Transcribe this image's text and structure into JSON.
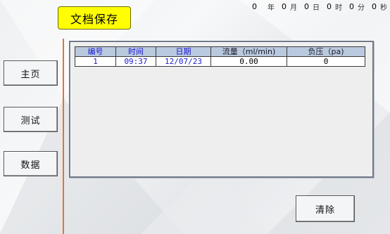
{
  "header": {
    "title": "文档保存"
  },
  "clock": {
    "year": "0",
    "year_unit": "年",
    "month": "0",
    "month_unit": "月",
    "day": "0",
    "day_unit": "日",
    "hour": "0",
    "hour_unit": "时",
    "minute": "0",
    "minute_unit": "分",
    "second": "0",
    "second_unit": "秒"
  },
  "nav": {
    "home": "主页",
    "test": "测试",
    "data": "数据"
  },
  "table": {
    "headers": [
      "编号",
      "时间",
      "日期",
      "流量（ml/min)",
      "负压（pa)"
    ],
    "rows": [
      [
        "1",
        "09:37",
        "12/07/23",
        "0.00",
        "0"
      ]
    ]
  },
  "actions": {
    "clear": "清除"
  },
  "colors": {
    "title_bg": "#ffff00",
    "divider": "#e8703a",
    "header_bg": "#b9c9de",
    "header_text": "#1b1bd0"
  }
}
